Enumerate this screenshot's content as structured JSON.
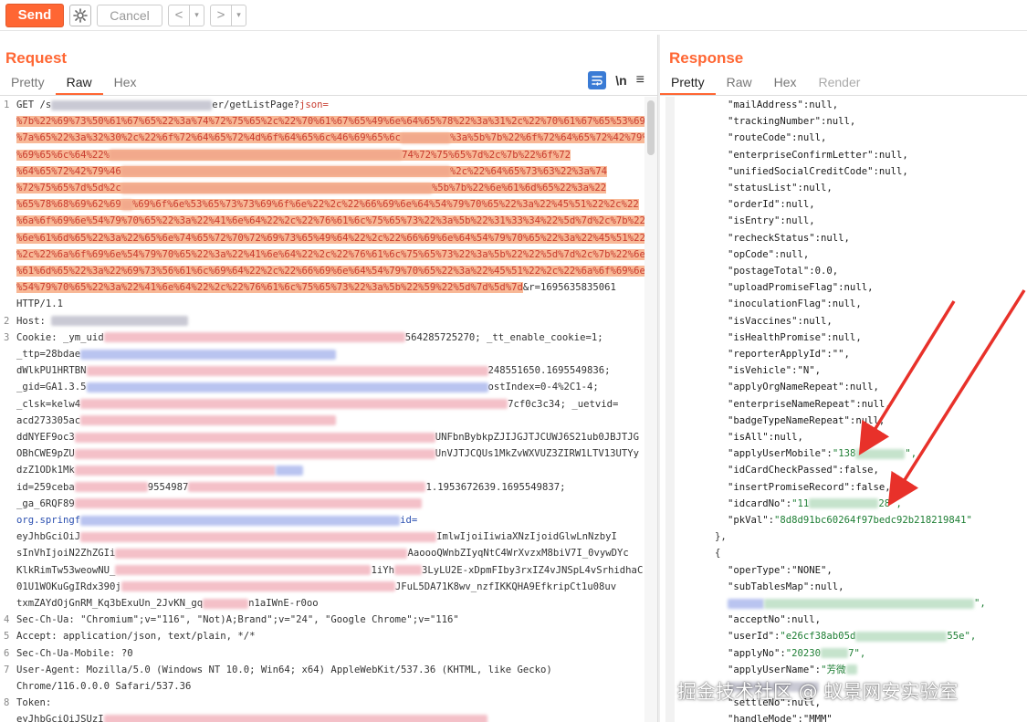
{
  "toolbar": {
    "send": "Send",
    "cancel": "Cancel",
    "back": "<",
    "forward": ">",
    "dropdown": "▾"
  },
  "request": {
    "title": "Request",
    "tabs": [
      "Pretty",
      "Raw",
      "Hex"
    ],
    "active_tab": "Raw",
    "tool_newline": "\\n",
    "lines": {
      "l1a": "GET /s",
      "l1b": "er/getListPage?",
      "l1c": "json=",
      "enc1": "%7b%22%69%73%50%61%67%65%22%3a%74%72%75%65%2c%22%70%61%67%65%49%6e%64%65%78%22%3a%31%2c%22%70%61%67%65%53%69",
      "enc2": "%7a%65%22%3a%32%30%2c%22%6f%72%64%65%72%4d%6f%64%65%6c%46%69%65%6c",
      "enc2b": "%3a%5b%7b%22%6f%72%64%65%72%42%79%46",
      "enc3": "%69%65%6c%64%22%",
      "enc3b": "74%72%75%65%7d%2c%7b%22%6f%72",
      "enc4": "%64%65%72%42%79%46",
      "enc4b": "%2c%22%64%65%73%63%22%3a%74",
      "enc5": "%72%75%65%7d%5d%2c",
      "enc5b": "%5b%7b%22%6e%61%6d%65%22%3a%22",
      "enc6": "%65%78%68%69%62%69",
      "enc6b": "%69%6f%6e%53%65%73%73%69%6f%6e%22%2c%22%66%69%6e%64%54%79%70%65%22%3a%22%45%51%22%2c%22",
      "enc7": "%6a%6f%69%6e%54%79%70%65%22%3a%22%41%6e%64%22%2c%22%76%61%6c%75%65%73%22%3a%5b%22%31%33%34%22%5d%7d%2c%7b%22",
      "enc8": "%6e%61%6d%65%22%3a%22%65%6e%74%65%72%70%72%69%73%65%49%64%22%2c%22%66%69%6e%64%54%79%70%65%22%3a%22%45%51%22",
      "enc9": "%2c%22%6a%6f%69%6e%54%79%70%65%22%3a%22%41%6e%64%22%2c%22%76%61%6c%75%65%73%22%3a%5b%22%22%5d%7d%2c%7b%22%6e",
      "enc10": "%61%6d%65%22%3a%22%69%73%56%61%6c%69%64%22%2c%22%66%69%6e%64%54%79%70%65%22%3a%22%45%51%22%2c%22%6a%6f%69%6e",
      "enc11": "%54%79%70%65%22%3a%22%41%6e%64%22%2c%22%76%61%6c%75%65%73%22%3a%5b%22%59%22%5d%7d%5d%7d",
      "enc11b": "&r=1695635835061",
      "http": "HTTP/1.1",
      "host": "Host:",
      "cookie": "Cookie:",
      "cookie_a": "_ym_uid",
      "cookie_b": "564285725270;",
      "cookie_c": "_tt_enable_cookie=1;",
      "ttp": "_ttp=28bdae",
      "dw": "dWlkPU1HRTBN",
      "dw_b": "248551650.1695549836;",
      "gid": "_gid=GA1.3.5",
      "gid_b": "ostIndex=0-4%2C1-4;",
      "clsk": "_clsk=kelw4",
      "clsk_b": "7cf0c3c34;",
      "uetvid": "_uetvid=",
      "acd": "acd273305ac",
      "dd": "ddNYEF9oc3",
      "dd_b": "UNFbnBybkpZJIJGJTJCUWJ6S21ub0JBJTJG",
      "ob": "OBhCWE9pZU",
      "ob_b": "UnVJTJCQUs1MkZvWXVUZ3ZIRW1LTV13UTYy",
      "dz": "dzZ1ODk1Mk",
      "id": "id=259ceba",
      "id_b": "9554987",
      "id_c": "1.1953672639.1695549837;",
      "ga": "_ga_6RQF89",
      "org": "org.springf",
      "org_b": "id=",
      "ey": "eyJhbGciOiJ",
      "ey_b": "ImlwIjoiIiwiaXNzIjoidGlwLnNzbyI",
      "si": "sInVhIjoiN2ZhZGIi",
      "si_b": "AaoooQWnbZIyqNtC4WrXvzxM8biV7I_0vywDYc",
      "kl": "KlkRimTw53weowNU_",
      "kl_b": "1iYh",
      "kl_c": "3LyLU2E-xDpmFIby3rxIZ4vJNSpL4vSrhidhaC",
      "u1": "01U1WOKuGgIRdx390j",
      "u1_b": "JFuL5DA71K8wv_nzfIKKQHA9EfkripCt1u08uv",
      "tx": "txmZAYdOjGnRM_Kq3bExuUn_2JvKN_gq",
      "tx_b": "n1aIWnE-r0oo",
      "secua": "Sec-Ch-Ua:",
      "secua_v": "\"Chromium\";v=\"116\", \"Not)A;Brand\";v=\"24\", \"Google Chrome\";v=\"116\"",
      "accept": "Accept:",
      "accept_v": "application/json, text/plain, */*",
      "mobile": "Sec-Ch-Ua-Mobile:",
      "mobile_v": "?0",
      "ua": "User-Agent:",
      "ua_v": "Mozilla/5.0 (Windows NT 10.0; Win64; x64) AppleWebKit/537.36 (KHTML, like Gecko)",
      "ua_v2": "Chrome/116.0.0.0 Safari/537.36",
      "token": "Token:",
      "token_v": "eyJhbGciOiJSUzI"
    },
    "line_numbers": [
      "1",
      "2",
      "3",
      "4",
      "5",
      "6",
      "7",
      "8"
    ]
  },
  "response": {
    "title": "Response",
    "tabs": [
      "Pretty",
      "Raw",
      "Hex",
      "Render"
    ],
    "active_tab": "Pretty",
    "rows": {
      "r0": "\"mailAddress\":null,",
      "r1": "\"trackingNumber\":null,",
      "r2": "\"routeCode\":null,",
      "r3": "\"enterpriseConfirmLetter\":null,",
      "r4": "\"unifiedSocialCreditCode\":null,",
      "r5": "\"statusList\":null,",
      "r6": "\"orderId\":null,",
      "r7": "\"isEntry\":null,",
      "r8": "\"recheckStatus\":null,",
      "r9": "\"opCode\":null,",
      "r10": "\"postageTotal\":0.0,",
      "r11": "\"uploadPromiseFlag\":null,",
      "r12": "\"inoculationFlag\":null,",
      "r13": "\"isVaccines\":null,",
      "r14": "\"isHealthPromise\":null,",
      "r15": "\"reporterApplyId\":\"\",",
      "r16": "\"isVehicle\":\"N\",",
      "r17": "\"applyOrgNameRepeat\":null,",
      "r18": "\"enterpriseNameRepeat\":null,",
      "r19": "\"badgeTypeNameRepeat\":null,",
      "r20": "\"isAll\":null,",
      "r21k": "\"applyUserMobile\":",
      "r21v": "\"138",
      "r21e": "\",",
      "r22": "\"idCardCheckPassed\":false,",
      "r23": "\"insertPromiseRecord\":false,",
      "r24k": "\"idcardNo\":",
      "r24v": "\"11",
      "r24v2": "28\",",
      "r25k": "\"pkVal\":",
      "r25v": "\"8d8d91bc60264f97bedc92b218219841\"",
      "r26": "},",
      "r27": "{",
      "r28": "\"operType\":\"NONE\",",
      "r29": "\"subTablesMap\":null,",
      "r30e": "\",",
      "r31": "\"acceptNo\":null,",
      "r32k": "\"userId\":",
      "r32v": "\"e26cf38ab05d",
      "r32v2": "55e\",",
      "r33k": "\"applyNo\":",
      "r33v": "\"20230",
      "r33v2": "7\",",
      "r34k": "\"applyUserName\":",
      "r34v": "\"芳微",
      "r35": "\"settleNo\":null,",
      "r36": "\"handleMode\":\"MMM\""
    }
  },
  "watermark": "掘金技术社区 @ 蚁景网安实验室",
  "colors": {
    "accent": "#ff6633",
    "highlight": "#f8b896",
    "arrow": "#e8312a"
  }
}
